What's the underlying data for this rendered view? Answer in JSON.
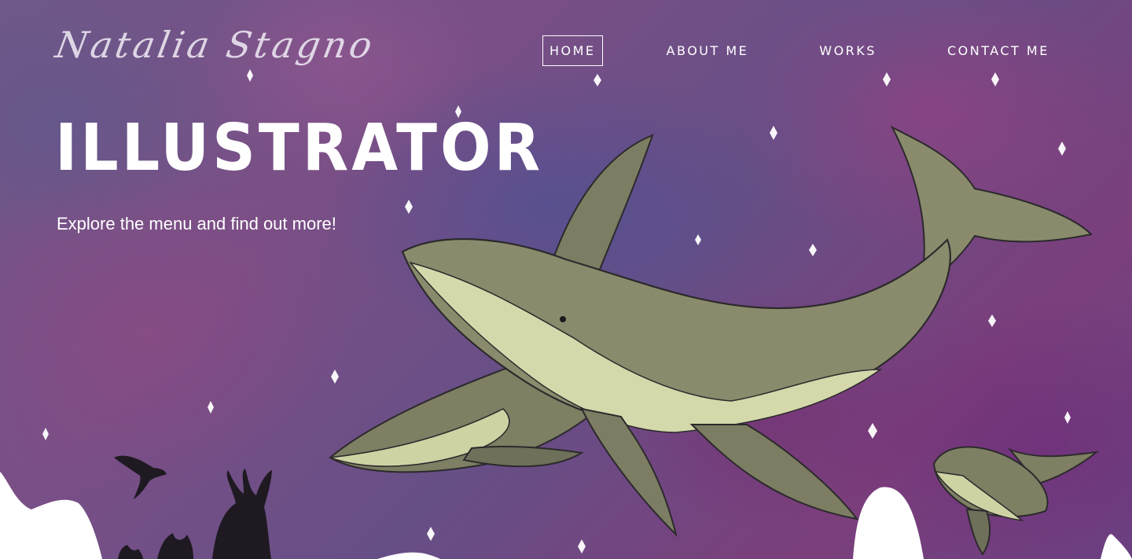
{
  "header": {
    "logo_text": "Natalia Stagno",
    "nav": [
      {
        "label": "HOME",
        "active": true
      },
      {
        "label": "ABOUT ME",
        "active": false
      },
      {
        "label": "WORKS",
        "active": false
      },
      {
        "label": "CONTACT ME",
        "active": false
      }
    ]
  },
  "hero": {
    "title": "ILLUSTRATOR",
    "subtitle": "Explore the menu and find out more!",
    "illustration": "whales-night-sky",
    "colors": {
      "sky": "#6d5889",
      "whale_body": "#86876b",
      "whale_belly": "#cfd3a4",
      "silhouette": "#1f1a22"
    }
  }
}
